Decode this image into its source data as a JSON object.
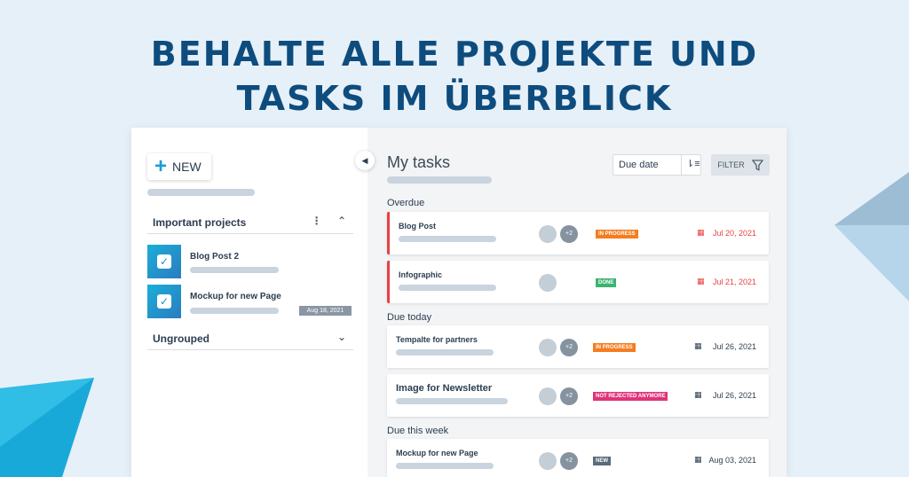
{
  "headline": {
    "line1": "BEHALTE ALLE PROJEKTE UND",
    "line2": "TASKS IM ÜBERBLICK"
  },
  "colors": {
    "accent": "#1a9ed8",
    "overdue": "#e84045",
    "in_progress": "#f57c1f",
    "done": "#3cb371",
    "not_rejected": "#e0337a",
    "new": "#5a6b7a"
  },
  "sidebar": {
    "new_button": {
      "icon": "plus-icon",
      "label": "NEW"
    },
    "important_projects": {
      "title": "Important projects",
      "items": [
        {
          "title": "Blog Post 2",
          "icon": "checkbox-icon"
        },
        {
          "title": "Mockup for new Page",
          "date": "Aug 18, 2021",
          "icon": "checkbox-icon"
        }
      ]
    },
    "ungrouped": {
      "title": "Ungrouped"
    }
  },
  "main": {
    "title": "My tasks",
    "sort": {
      "value": "Due date"
    },
    "filter_label": "FILTER",
    "groups": [
      {
        "label": "Overdue",
        "tasks": [
          {
            "name": "Blog Post",
            "status": "IN PROGRESS",
            "date": "Jul 20, 2021",
            "extra_assignees": "+2"
          },
          {
            "name": "Infographic",
            "status": "DONE",
            "date": "Jul 21, 2021"
          }
        ]
      },
      {
        "label": "Due today",
        "tasks": [
          {
            "name": "Tempalte for partners",
            "status": "IN PROGRESS",
            "date": "Jul 26, 2021",
            "extra_assignees": "+2"
          },
          {
            "name": "Image for Newsletter",
            "status": "NOT REJECTED ANYMORE",
            "date": "Jul 26, 2021",
            "extra_assignees": "+2"
          }
        ]
      },
      {
        "label": "Due this week",
        "tasks": [
          {
            "name": "Mockup for new Page",
            "status": "NEW",
            "date": "Aug 03, 2021",
            "extra_assignees": "+2"
          }
        ]
      }
    ]
  }
}
